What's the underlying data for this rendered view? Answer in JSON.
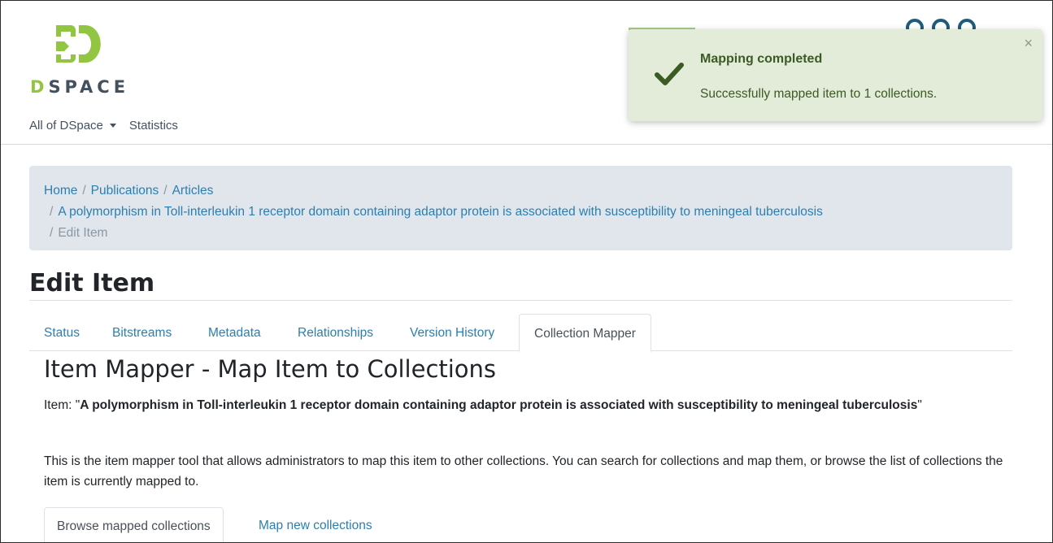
{
  "brand": {
    "logo_letter": "D",
    "logo_rest": "SPACE",
    "accent": "#92c642",
    "text_color": "#43515f"
  },
  "nav": {
    "items": [
      {
        "label": "All of DSpace",
        "has_dropdown": true
      },
      {
        "label": "Statistics",
        "has_dropdown": false
      }
    ]
  },
  "toast": {
    "title": "Mapping completed",
    "message": "Successfully mapped item to 1 collections.",
    "close": "×",
    "icon": "checkmark-icon",
    "background": "#e2ecd8"
  },
  "breadcrumb": {
    "items": [
      {
        "label": "Home"
      },
      {
        "label": "Publications"
      },
      {
        "label": "Articles"
      },
      {
        "label": "A polymorphism in Toll-interleukin 1 receptor domain containing adaptor protein is associated with susceptibility to meningeal tuberculosis"
      },
      {
        "label": "Edit Item"
      }
    ],
    "separator": "/"
  },
  "page": {
    "title": "Edit Item"
  },
  "tabs": [
    {
      "label": "Status"
    },
    {
      "label": "Bitstreams"
    },
    {
      "label": "Metadata"
    },
    {
      "label": "Relationships"
    },
    {
      "label": "Version History"
    },
    {
      "label": "Collection Mapper",
      "active": true
    }
  ],
  "mapper": {
    "title": "Item Mapper - Map Item to Collections",
    "item_prefix": "Item: \"",
    "item_name": "A polymorphism in Toll-interleukin 1 receptor domain containing adaptor protein is associated with susceptibility to meningeal tuberculosis",
    "item_suffix": "\"",
    "description": "This is the item mapper tool that allows administrators to map this item to other collections. You can search for collections and map them, or browse the list of collections the item is currently mapped to."
  },
  "subtabs": [
    {
      "label": "Browse mapped collections",
      "active": true
    },
    {
      "label": "Map new collections"
    }
  ]
}
